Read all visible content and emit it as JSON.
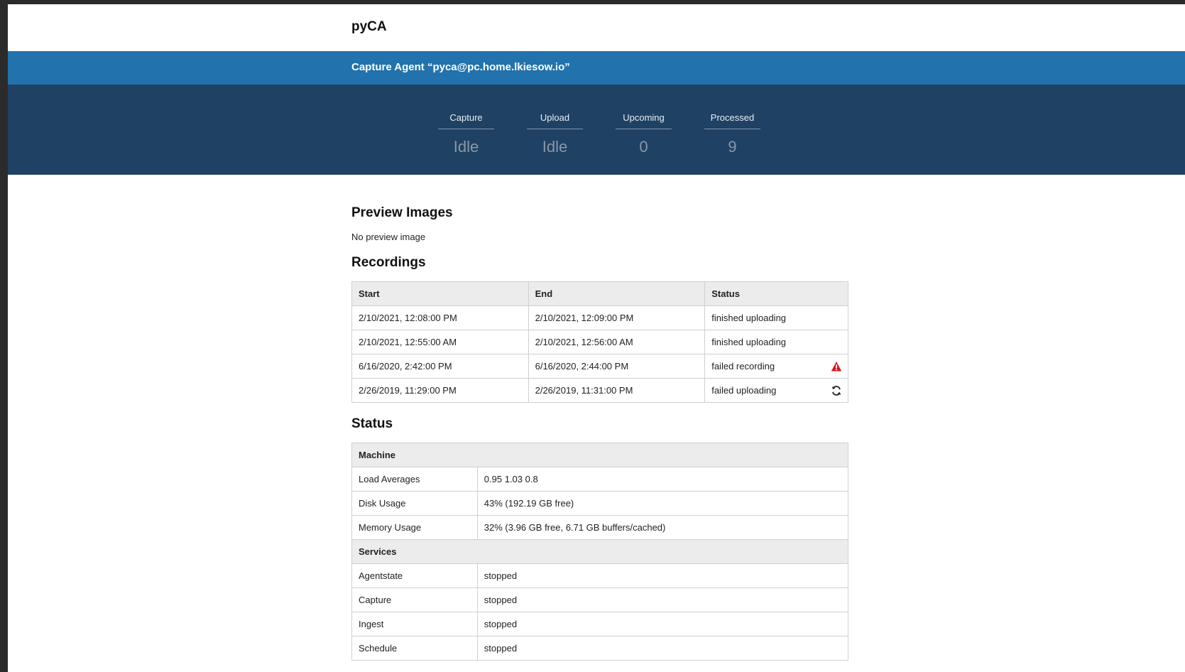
{
  "app": {
    "brand": "pyCA"
  },
  "agent": {
    "title": "Capture Agent “pyca@pc.home.lkiesow.io”"
  },
  "stats": [
    {
      "label": "Capture",
      "value": "Idle"
    },
    {
      "label": "Upload",
      "value": "Idle"
    },
    {
      "label": "Upcoming",
      "value": "0"
    },
    {
      "label": "Processed",
      "value": "9"
    }
  ],
  "preview": {
    "heading": "Preview Images",
    "empty_text": "No preview image"
  },
  "recordings": {
    "heading": "Recordings",
    "columns": [
      "Start",
      "End",
      "Status"
    ],
    "rows": [
      {
        "start": "2/10/2021, 12:08:00 PM",
        "end": "2/10/2021, 12:09:00 PM",
        "status": "finished uploading",
        "icon": ""
      },
      {
        "start": "2/10/2021, 12:55:00 AM",
        "end": "2/10/2021, 12:56:00 AM",
        "status": "finished uploading",
        "icon": ""
      },
      {
        "start": "6/16/2020, 2:42:00 PM",
        "end": "6/16/2020, 2:44:00 PM",
        "status": "failed recording",
        "icon": "warning-icon"
      },
      {
        "start": "2/26/2019, 11:29:00 PM",
        "end": "2/26/2019, 11:31:00 PM",
        "status": "failed uploading",
        "icon": "retry-icon"
      }
    ]
  },
  "status": {
    "heading": "Status",
    "machine": {
      "heading": "Machine",
      "rows": [
        {
          "key": "Load Averages",
          "value": "0.95 1.03 0.8"
        },
        {
          "key": "Disk Usage",
          "value": "43% (192.19 GB free)"
        },
        {
          "key": "Memory Usage",
          "value": "32% (3.96 GB free, 6.71 GB buffers/cached)"
        }
      ]
    },
    "services": {
      "heading": "Services",
      "rows": [
        {
          "key": "Agentstate",
          "value": "stopped"
        },
        {
          "key": "Capture",
          "value": "stopped"
        },
        {
          "key": "Ingest",
          "value": "stopped"
        },
        {
          "key": "Schedule",
          "value": "stopped"
        }
      ]
    }
  },
  "colors": {
    "subbar": "#2172ad",
    "hero": "#1f4164",
    "warning": "#d9161c"
  }
}
